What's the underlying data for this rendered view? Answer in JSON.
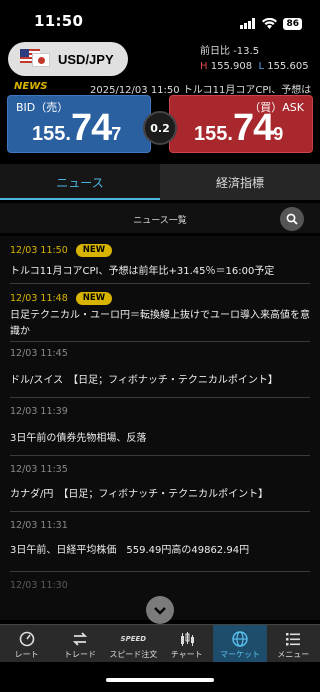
{
  "status_bar": {
    "time": "11:50",
    "battery": "86"
  },
  "pair": {
    "label": "USD/JPY"
  },
  "stats": {
    "change_label": "前日比",
    "change_value": "-13.5",
    "high_label": "H",
    "high_value": "155.908",
    "low_label": "L",
    "low_value": "155.605"
  },
  "ticker": {
    "tag": "NEWS",
    "text": "2025/12/03 11:50  トルコ11月コアCPI、予想は"
  },
  "bid": {
    "label": "BID（売）",
    "price_small": "155.",
    "price_big": "74",
    "price_tiny": "7"
  },
  "ask": {
    "label": "（買）ASK",
    "price_small": "155.",
    "price_big": "74",
    "price_tiny": "9"
  },
  "spread": "0.2",
  "tabs": [
    {
      "label": "ニュース"
    },
    {
      "label": "経済指標"
    }
  ],
  "subheader": {
    "title": "ニュース一覧"
  },
  "news": [
    {
      "date": "12/03 11:50",
      "badge": "NEW",
      "title": "トルコ11月コアCPI、予想は前年比+31.45％＝16:00予定"
    },
    {
      "date": "12/03 11:48",
      "badge": "NEW",
      "title": "日足テクニカル・ユーロ円＝転換線上抜けでユーロ導入来高値を意識か"
    },
    {
      "date": "12/03 11:45",
      "badge": "",
      "title": "ドル/スイス　【日足；フィボナッチ・テクニカルポイント】"
    },
    {
      "date": "12/03 11:39",
      "badge": "",
      "title": "3日午前の債券先物相場、反落"
    },
    {
      "date": "12/03 11:35",
      "badge": "",
      "title": "カナダ/円　【日足；フィボナッチ・テクニカルポイント】"
    },
    {
      "date": "12/03 11:31",
      "badge": "",
      "title": "3日午前、日経平均株価　559.49円高の49862.94円"
    },
    {
      "date": "12/03 11:30",
      "badge": "",
      "title": ""
    }
  ],
  "nav": [
    {
      "label": "レート",
      "icon": "rate-icon"
    },
    {
      "label": "トレード",
      "icon": "trade-icon"
    },
    {
      "label": "スピード注文",
      "icon": "speed-icon",
      "icon_text": "SPEED"
    },
    {
      "label": "チャート",
      "icon": "chart-icon"
    },
    {
      "label": "マーケット",
      "icon": "globe-icon"
    },
    {
      "label": "メニュー",
      "icon": "menu-icon"
    }
  ],
  "colors": {
    "accent": "#4db6e0",
    "bid": "#2a5fa0",
    "ask": "#a8282d",
    "news_tag": "#d8b400"
  }
}
